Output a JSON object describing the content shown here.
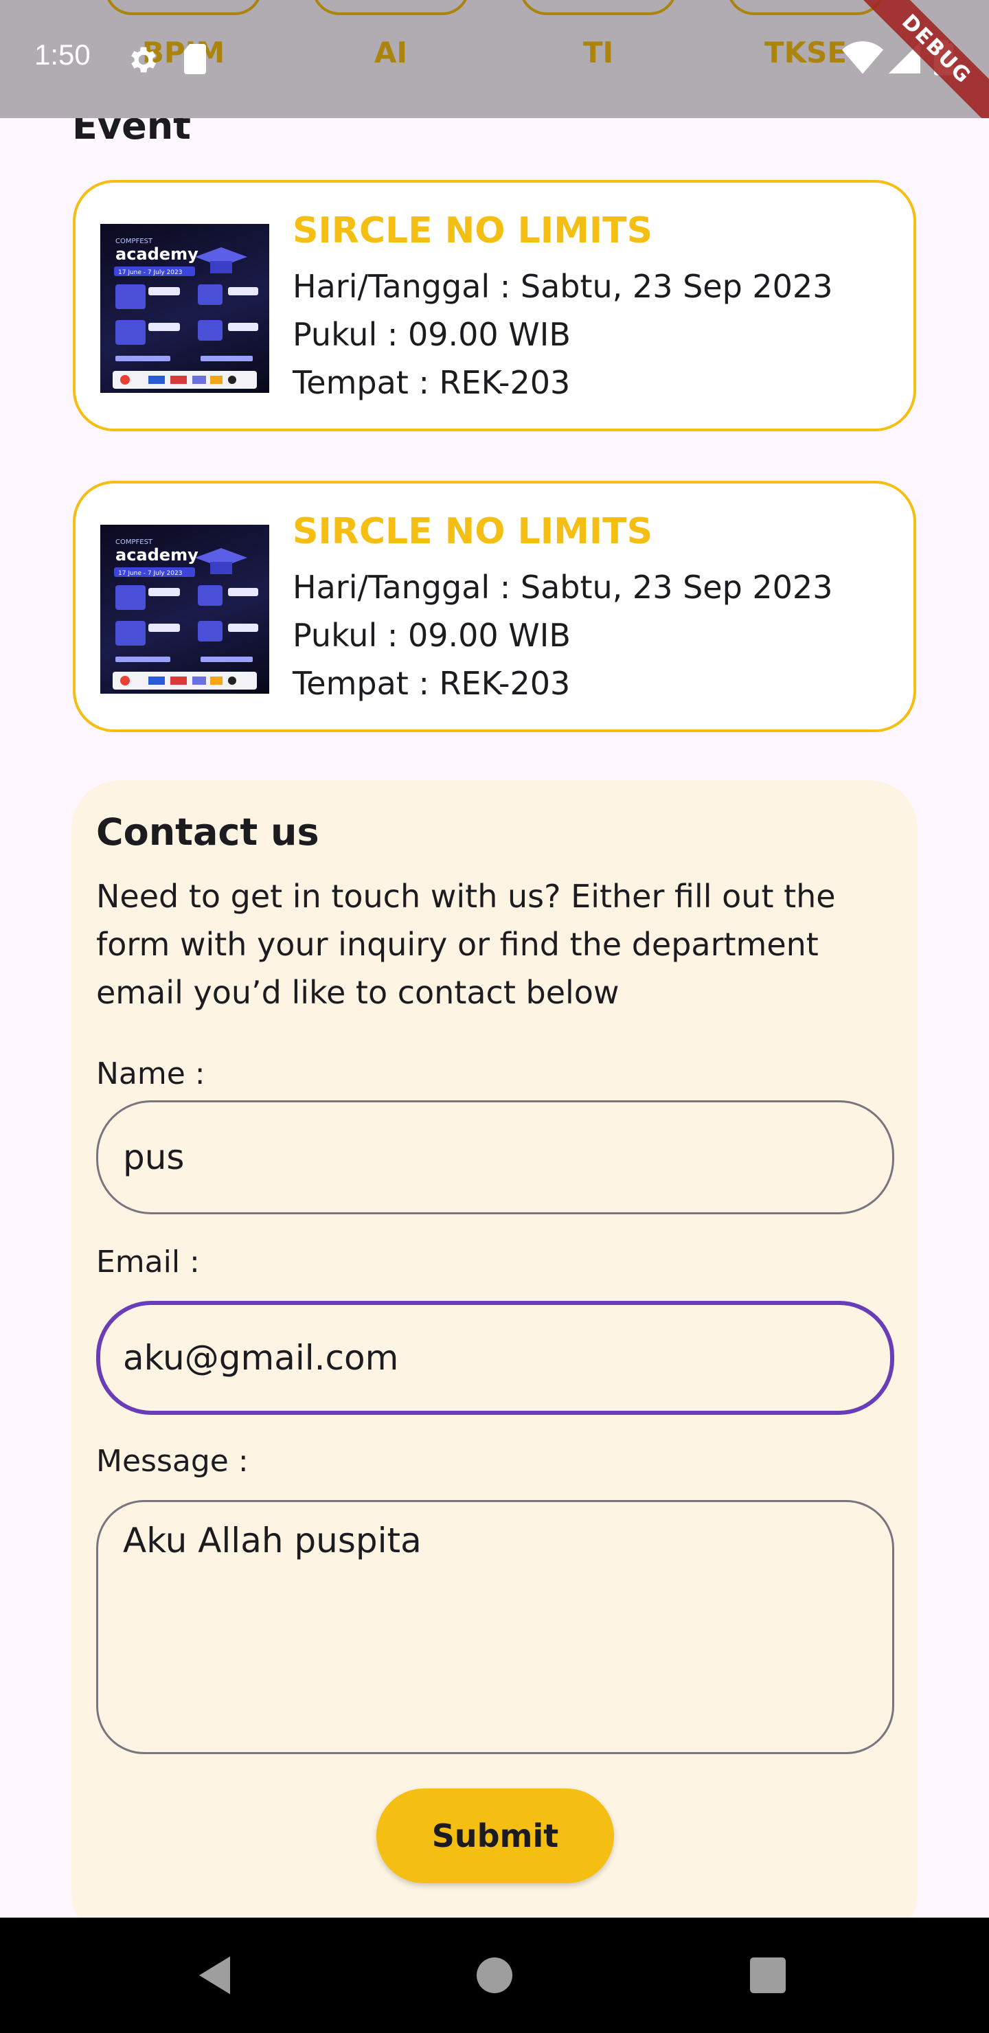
{
  "status_bar": {
    "time": "1:50",
    "icons": [
      "gear-icon",
      "sd-card-icon",
      "wifi-icon",
      "signal-icon",
      "battery-icon"
    ],
    "debug_banner": "DEBUG"
  },
  "categories": [
    {
      "label": "BPIM"
    },
    {
      "label": "AI"
    },
    {
      "label": "TI"
    },
    {
      "label": "TKSE"
    }
  ],
  "event_section": {
    "title": "Event",
    "events": [
      {
        "title": "SIRCLE NO LIMITS",
        "date_line": "Hari/Tanggal : Sabtu, 23 Sep 2023",
        "time_line": "Pukul : 09.00 WIB",
        "place_line": "Tempat : REK-203",
        "poster": {
          "brand": "academy",
          "kicker": "COMPFEST",
          "dates": "17 June - 7 July 2023"
        }
      },
      {
        "title": "SIRCLE NO LIMITS",
        "date_line": "Hari/Tanggal : Sabtu, 23 Sep 2023",
        "time_line": "Pukul : 09.00 WIB",
        "place_line": "Tempat : REK-203",
        "poster": {
          "brand": "academy",
          "kicker": "COMPFEST",
          "dates": "17 June - 7 July 2023"
        }
      }
    ]
  },
  "contact": {
    "title": "Contact us",
    "description": "Need to get in touch with us? Either fill out the form with your inquiry or find the department email you’d like to contact below",
    "name_label": "Name :",
    "name_value": "pus",
    "email_label": "Email :",
    "email_value": "aku@gmail.com",
    "message_label": "Message :",
    "message_value": "Aku Allah puspita",
    "submit_label": "Submit"
  },
  "colors": {
    "accent": "#F4BE12",
    "focus": "#6A3DB8",
    "contact_bg": "#FDF4E3",
    "page_bg": "#FEF7FF",
    "nav_bg": "#000000"
  },
  "nav_bar": {
    "icons": [
      "back-icon",
      "home-icon",
      "recents-icon"
    ]
  }
}
